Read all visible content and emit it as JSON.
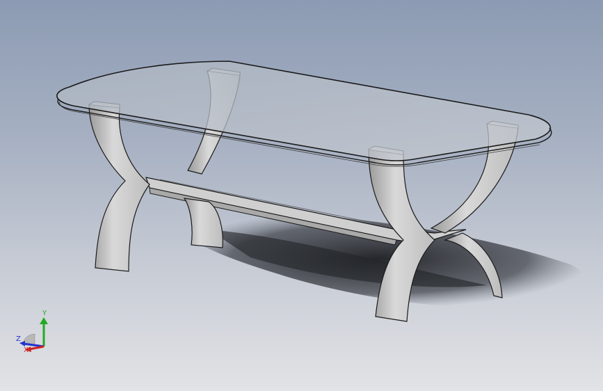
{
  "viewport": {
    "background_top": "#8c9bb3",
    "background_bottom": "#e2e3e6"
  },
  "model": {
    "name": "coffee-table",
    "glass_color": "#b5bcc6",
    "frame_color": "#d6d6d6",
    "edge_color": "#1a1a1a",
    "shadow_color": "#2a2c30"
  },
  "triad": {
    "y_label": "Y",
    "z_label": "Z",
    "x_label": "X",
    "y_color": "#22aa22",
    "z_color": "#2233cc",
    "x_color": "#cc2222"
  }
}
